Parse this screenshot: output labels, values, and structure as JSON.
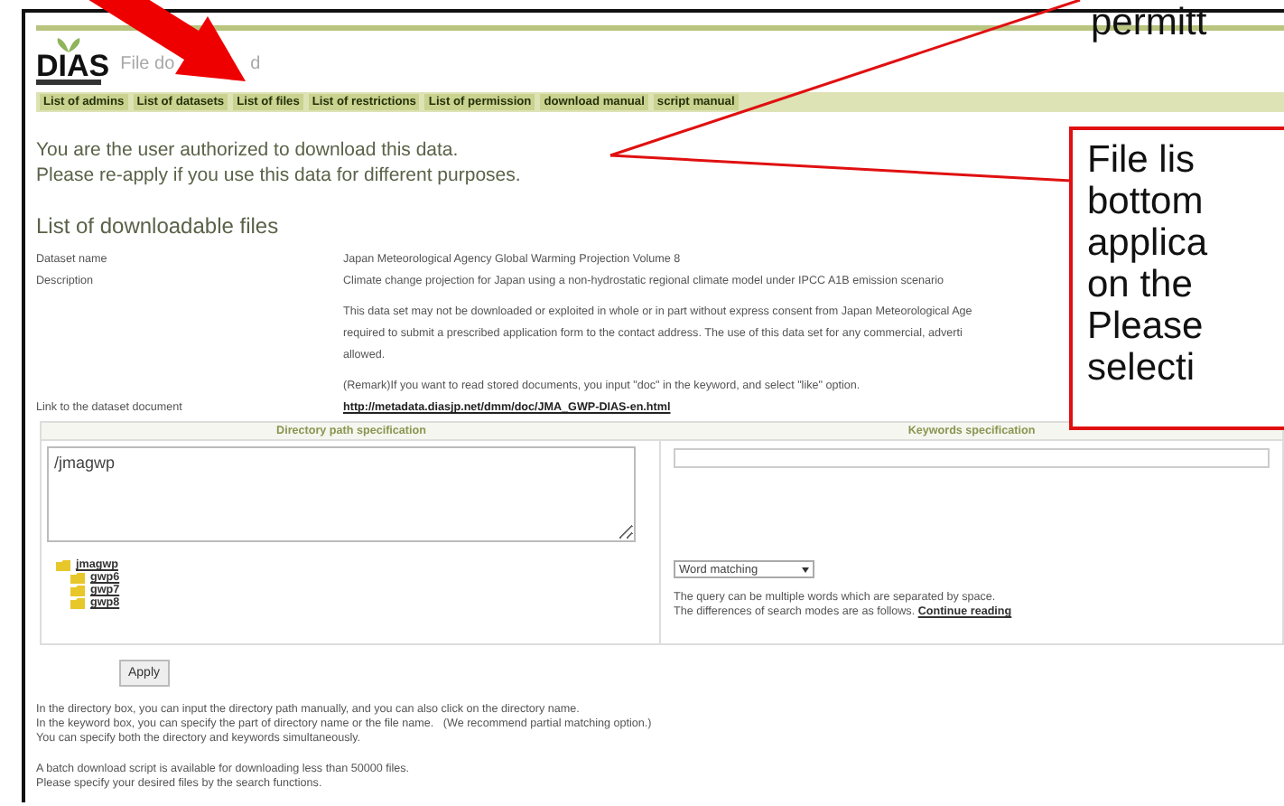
{
  "header": {
    "logo": "DIAS",
    "title_parts": [
      "File do",
      "d"
    ]
  },
  "nav": [
    {
      "label": "List of admins",
      "selected": false
    },
    {
      "label": "List of datasets",
      "selected": false
    },
    {
      "label": "List of files",
      "selected": false
    },
    {
      "label": "List of restrictions",
      "selected": false
    },
    {
      "label": "List of permission",
      "selected": false
    },
    {
      "label": "download manual",
      "selected": false
    },
    {
      "label": "script manual",
      "selected": false
    }
  ],
  "notice": [
    "You are the user authorized to download this data.",
    "Please re-apply if you use this data for different purposes."
  ],
  "section_title": "List of downloadable files",
  "details": [
    {
      "kind": "text",
      "label": "Dataset name",
      "paragraphs": [
        [
          "Japan Meteorological Agency Global Warming Projection Volume 8"
        ]
      ]
    },
    {
      "kind": "text",
      "label": "Description",
      "paragraphs": [
        [
          "Climate change projection for Japan using a non-hydrostatic regional climate model under IPCC A1B emission scenario"
        ],
        [
          "This data set may not be downloaded or exploited in whole or in part without express consent from Japan Meteorological Age",
          "required to submit a prescribed application form to the contact address. The use of this data set for any commercial, adverti",
          "allowed."
        ],
        [
          "(Remark)If you want to read stored documents, you input \"doc\" in the keyword, and select \"like\" option."
        ]
      ]
    },
    {
      "kind": "link",
      "label": "Link to the dataset document",
      "value": "http://metadata.diasjp.net/dmm/doc/JMA_GWP-DIAS-en.html"
    }
  ],
  "search": {
    "directory": {
      "heading": "Directory path specification",
      "value": "/jmagwp",
      "tree": [
        {
          "label": "jmagwp",
          "children": [
            {
              "label": "gwp6"
            },
            {
              "label": "gwp7"
            },
            {
              "label": "gwp8"
            }
          ]
        }
      ]
    },
    "keywords": {
      "heading": "Keywords specification",
      "match_mode": "Word matching",
      "help": [
        "The query can be multiple words which are separated by space.",
        "The differences of search modes are as follows."
      ],
      "more_link": "Continue reading"
    }
  },
  "apply_button": "Apply",
  "notes": [
    [
      "In the directory box, you can input the directory path manually, and you can also click on the directory name.",
      "In the keyword box, you can specify the part of directory name or the file name.   (We recommend partial matching option.)",
      "You can specify both the directory and keywords simultaneously."
    ],
    [
      "A batch download script is available for downloading less than 50000 files.",
      "Please specify your desired files by the search functions."
    ]
  ],
  "callouts": [
    {
      "kind": "open",
      "lines": [
        "permitt"
      ]
    },
    {
      "kind": "boxed",
      "lines": [
        "File lis",
        "bottom",
        "applica",
        "on the",
        "Please",
        "selecti"
      ]
    }
  ]
}
